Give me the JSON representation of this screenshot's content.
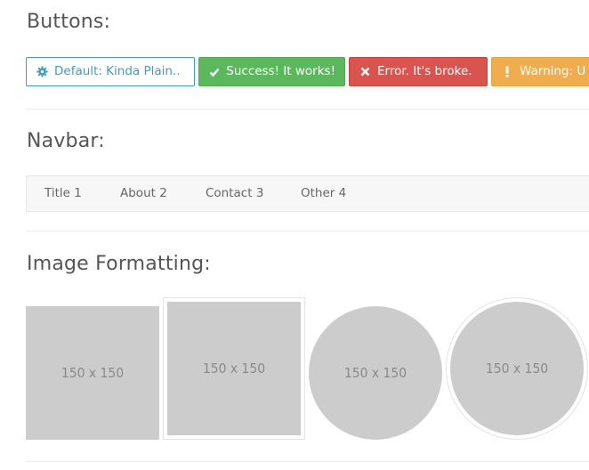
{
  "sections": {
    "buttons": {
      "title": "Buttons:"
    },
    "navbar": {
      "title": "Navbar:"
    },
    "images": {
      "title": "Image Formatting:"
    }
  },
  "buttons": [
    {
      "label": "Default: Kinda Plain..",
      "icon": "gear-icon",
      "variant": "default",
      "color": "#3d9fbf"
    },
    {
      "label": "Success! It works!",
      "icon": "check-icon",
      "variant": "success",
      "color": "#5cb85c"
    },
    {
      "label": "Error. It's broke.",
      "icon": "close-icon",
      "variant": "error",
      "color": "#d9534f"
    },
    {
      "label": "Warning: U",
      "icon": "exclamation-icon",
      "variant": "warning",
      "color": "#f0ad4e"
    }
  ],
  "navbar": {
    "items": [
      "Title 1",
      "About 2",
      "Contact 3",
      "Other 4"
    ]
  },
  "images": [
    {
      "label": "150 x 150",
      "style": "square"
    },
    {
      "label": "150 x 150",
      "style": "thumbnail"
    },
    {
      "label": "150 x 150",
      "style": "circle"
    },
    {
      "label": "150 x 150",
      "style": "circle-thumbnail"
    }
  ]
}
